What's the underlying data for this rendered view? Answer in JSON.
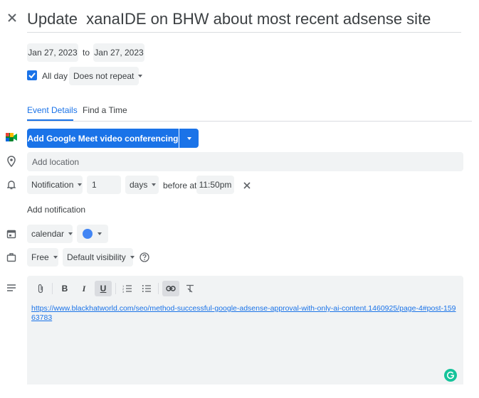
{
  "title": "Update  xanaIDE on BHW about most recent adsense site",
  "date": {
    "start": "Jan 27, 2023",
    "to": "to",
    "end": "Jan 27, 2023"
  },
  "allday": {
    "label": "All day",
    "checked": true
  },
  "repeat": {
    "value": "Does not repeat"
  },
  "tabs": [
    {
      "label": "Event Details",
      "active": true
    },
    {
      "label": "Find a Time",
      "active": false
    }
  ],
  "meet": {
    "button_label": "Add Google Meet video conferencing"
  },
  "location": {
    "placeholder": "Add location"
  },
  "notification": {
    "type": "Notification",
    "amount": "1",
    "unit": "days",
    "before_at": "before at",
    "time": "11:50pm"
  },
  "add_notification": "Add notification",
  "calendar": {
    "name": "calendar",
    "color": "#4285f4"
  },
  "busy": {
    "status": "Free",
    "visibility": "Default visibility"
  },
  "description": {
    "toolbar": [
      "attach",
      "bold",
      "italic",
      "underline",
      "numbered-list",
      "bulleted-list",
      "link",
      "remove-formatting"
    ],
    "link_text": "https://www.blackhatworld.com/seo/method-successful-google-adsense-approval-with-only-ai-content.1460925/page-4#post-15963783"
  },
  "colors": {
    "accent": "#1a73e8",
    "chip": "#f1f3f4",
    "meet_button": "#1a73e8",
    "grammarly": "#15c39a"
  }
}
